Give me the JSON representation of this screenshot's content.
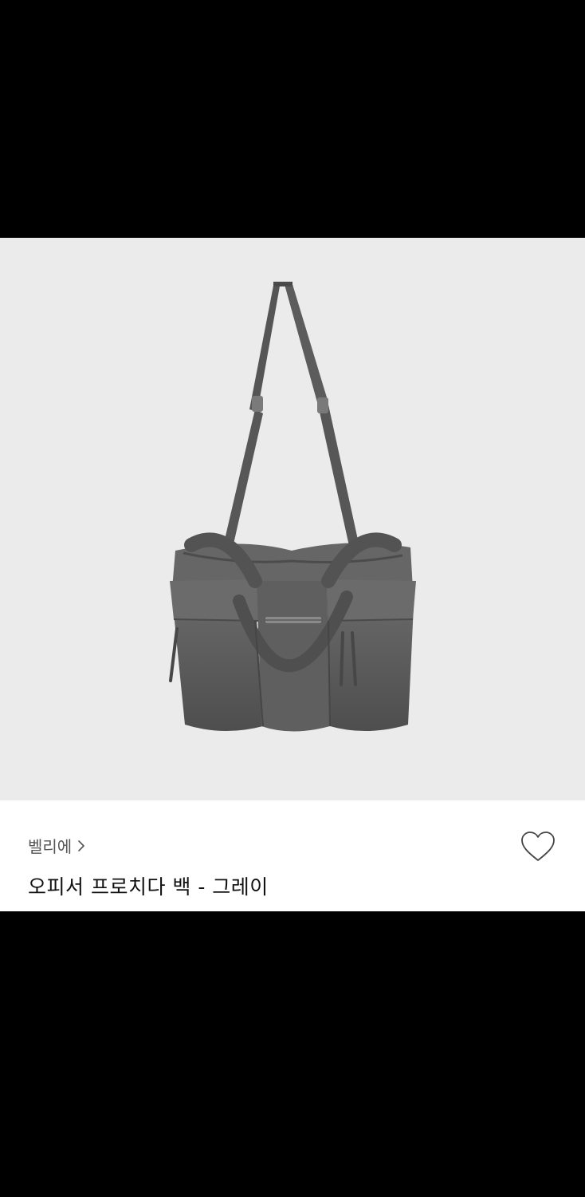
{
  "product": {
    "brand": "벨리에",
    "brand_chevron": "chevron-right-icon",
    "title": "오피서 프로치다 백 - 그레이",
    "like_icon": "heart-outline-icon",
    "image_subject": "gray-canvas-shoulder-bag"
  },
  "colors": {
    "letterbox": "#000000",
    "image_background": "#ebebeb",
    "bag": "#5b5b5b",
    "panel": "#ffffff",
    "brand_text": "#555555",
    "title_text": "#111111"
  }
}
